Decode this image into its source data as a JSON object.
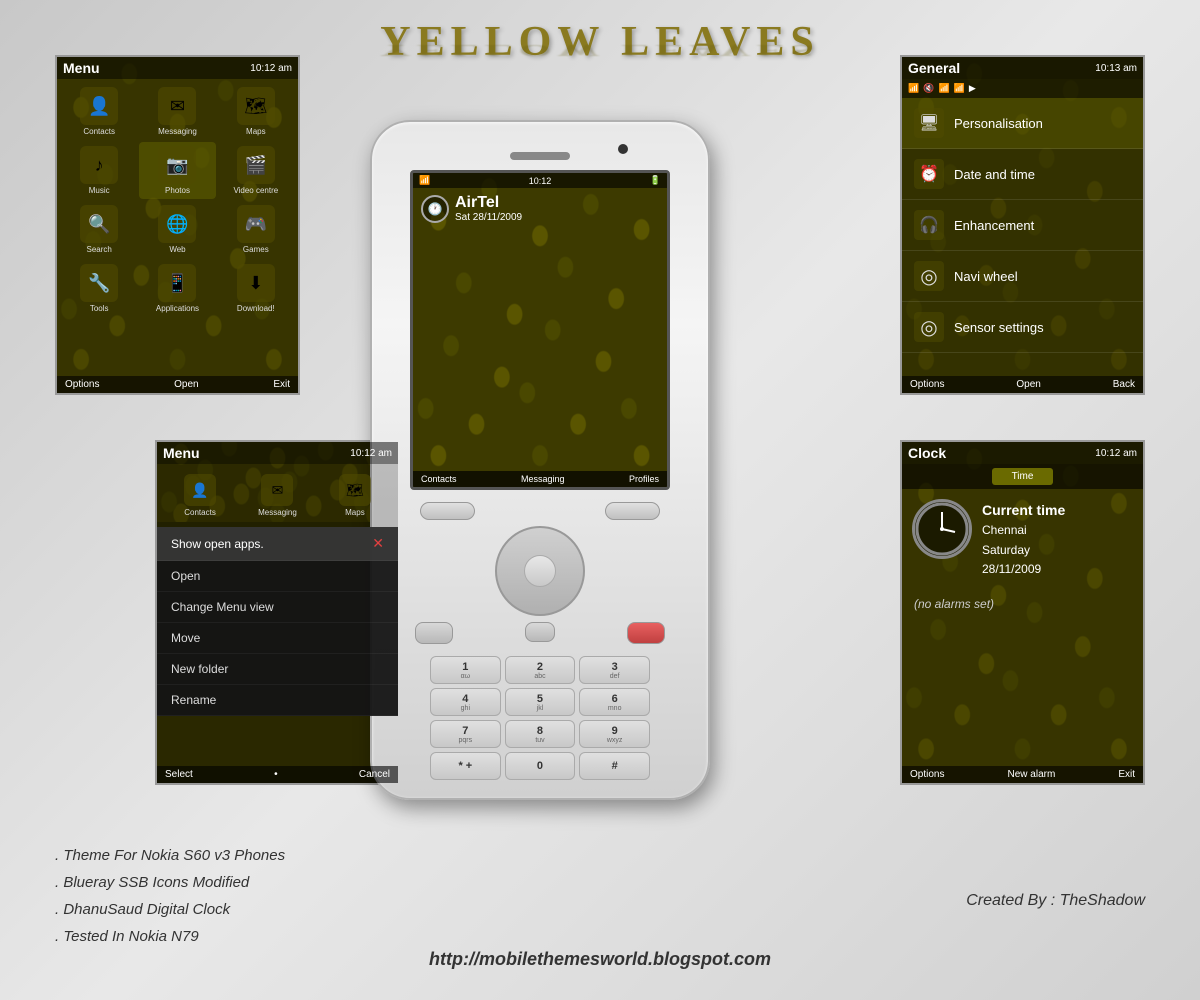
{
  "page": {
    "title": "Yellow Leaves",
    "title_shadow": "Yellow Leaves"
  },
  "top_left_panel": {
    "header_title": "Menu",
    "time": "10:12 am",
    "icons": [
      {
        "label": "Contacts",
        "icon": "👤"
      },
      {
        "label": "Messaging",
        "icon": "✉"
      },
      {
        "label": "Maps",
        "icon": "🗺"
      },
      {
        "label": "Music",
        "icon": "♪"
      },
      {
        "label": "Photos",
        "icon": "📷"
      },
      {
        "label": "Video centre",
        "icon": "🎬"
      },
      {
        "label": "Search",
        "icon": "🔍"
      },
      {
        "label": "Web",
        "icon": "🌐"
      },
      {
        "label": "Games",
        "icon": "🎮"
      },
      {
        "label": "Tools",
        "icon": "🔧"
      },
      {
        "label": "Applications",
        "icon": "📱"
      },
      {
        "label": "Download!",
        "icon": "⬇"
      }
    ],
    "footer": {
      "options": "Options",
      "open": "Open",
      "exit": "Exit"
    }
  },
  "top_right_panel": {
    "header_title": "General",
    "time": "10:13 am",
    "items": [
      {
        "label": "Personalisation",
        "icon": "🖥"
      },
      {
        "label": "Date and time",
        "icon": "⏰"
      },
      {
        "label": "Enhancement",
        "icon": "🎧"
      },
      {
        "label": "Navi wheel",
        "icon": "📡"
      },
      {
        "label": "Sensor settings",
        "icon": "📡"
      }
    ],
    "footer": {
      "options": "Options",
      "open": "Open",
      "back": "Back"
    }
  },
  "bottom_left_panel": {
    "header_title": "Menu",
    "time": "10:12 am",
    "top_icons": [
      {
        "label": "Contacts",
        "icon": "👤"
      },
      {
        "label": "Messaging",
        "icon": "✉"
      },
      {
        "label": "Maps",
        "icon": "🗺"
      }
    ],
    "context_items": [
      {
        "label": "Show open apps.",
        "has_dot": true
      },
      {
        "label": "Open",
        "has_dot": false
      },
      {
        "label": "Change Menu view",
        "has_dot": false
      },
      {
        "label": "Move",
        "has_dot": false
      },
      {
        "label": "New folder",
        "has_dot": false
      },
      {
        "label": "Rename",
        "has_dot": false
      }
    ],
    "footer": {
      "select": "Select",
      "cancel": "Cancel"
    }
  },
  "bottom_right_panel": {
    "header_title": "Clock",
    "time": "10:12 am",
    "tab_label": "Time",
    "current_time_label": "Current time",
    "city": "Chennai",
    "day": "Saturday",
    "date": "28/11/2009",
    "alarm_text": "(no alarms set)",
    "footer": {
      "options": "Options",
      "new_alarm": "New alarm",
      "exit": "Exit"
    }
  },
  "phone": {
    "carrier": "AirTel",
    "date": "Sat 28/11/2009",
    "bottom_bar": {
      "contacts": "Contacts",
      "messaging": "Messaging",
      "profiles": "Profiles"
    },
    "keypad": [
      {
        "num": "1",
        "alpha": "αω"
      },
      {
        "num": "2",
        "alpha": "abc"
      },
      {
        "num": "3",
        "alpha": "def"
      },
      {
        "num": "4",
        "alpha": "ghi"
      },
      {
        "num": "5",
        "alpha": "jkl"
      },
      {
        "num": "6",
        "alpha": "mno"
      },
      {
        "num": "7",
        "alpha": "pqrs"
      },
      {
        "num": "8",
        "alpha": "tuv"
      },
      {
        "num": "9",
        "alpha": "wxyz"
      },
      {
        "num": "*+",
        "alpha": ""
      },
      {
        "num": "0 ",
        "alpha": ""
      },
      {
        "num": "# ",
        "alpha": ""
      }
    ]
  },
  "bottom_info": {
    "lines": [
      ". Theme For Nokia S60 v3 Phones",
      ". Blueray SSB Icons Modified",
      ". DhanuSaud Digital Clock",
      ". Tested In Nokia N79"
    ],
    "credit": "Created By : TheShadow",
    "url": "http://mobilethemesworld.blogspot.com"
  }
}
